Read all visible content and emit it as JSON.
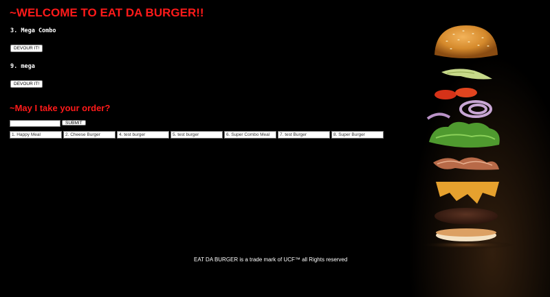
{
  "header": {
    "title": "~WELCOME TO EAT DA BURGER!!"
  },
  "burgers": [
    {
      "label": "3. Mega Combo",
      "button": "DEVOUR IT!"
    },
    {
      "label": "9. mega",
      "button": "DEVOUR IT!"
    }
  ],
  "order": {
    "title": "~May I take your order?",
    "input_value": "",
    "submit_label": "SUBMIT",
    "menu": [
      "1. Happy Meal",
      "2. Cheese Burger",
      "4. test burger",
      "5. test burger",
      "6. Super Combo Meal",
      "7. test Burger",
      "8. Super Burger"
    ]
  },
  "footer": {
    "text": "EAT DA BURGER is a trade mark of UCF™ all Rights reserved"
  },
  "colors": {
    "accent": "#ff1a1a",
    "background": "#000000"
  }
}
